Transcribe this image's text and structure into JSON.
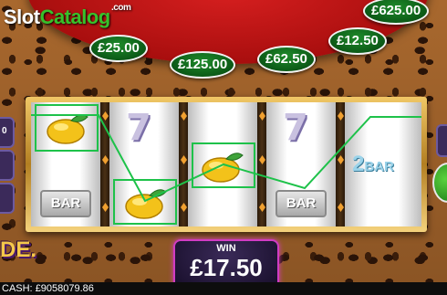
{
  "brand": {
    "logo_part1": "Slot",
    "logo_part2": "Catalog",
    "logo_suffix": ".com"
  },
  "prizes": [
    "£625.00",
    "£25.00",
    "£12.50",
    "£125.00",
    "£62.50"
  ],
  "side_left": {
    "value": "0"
  },
  "reels": {
    "reel1": {
      "top": "lemon",
      "bottom": "BAR"
    },
    "reel2": {
      "top": "7",
      "bottom": "lemon"
    },
    "reel3": {
      "middle": "lemon"
    },
    "reel4": {
      "top": "7",
      "bottom": "BAR"
    },
    "reel5": {
      "middle_label_num": "2",
      "middle_label_text": "BAR"
    }
  },
  "game_logo_fragment": "DE.",
  "win": {
    "label": "WIN",
    "amount": "£17.50"
  },
  "cash": {
    "label": "CASH:",
    "amount": "£9058079.86"
  },
  "colors": {
    "payline": "#1ec24a",
    "prize_oval": "#0c5a17",
    "banner": "#c41616",
    "win_border": "#d13cc3"
  }
}
